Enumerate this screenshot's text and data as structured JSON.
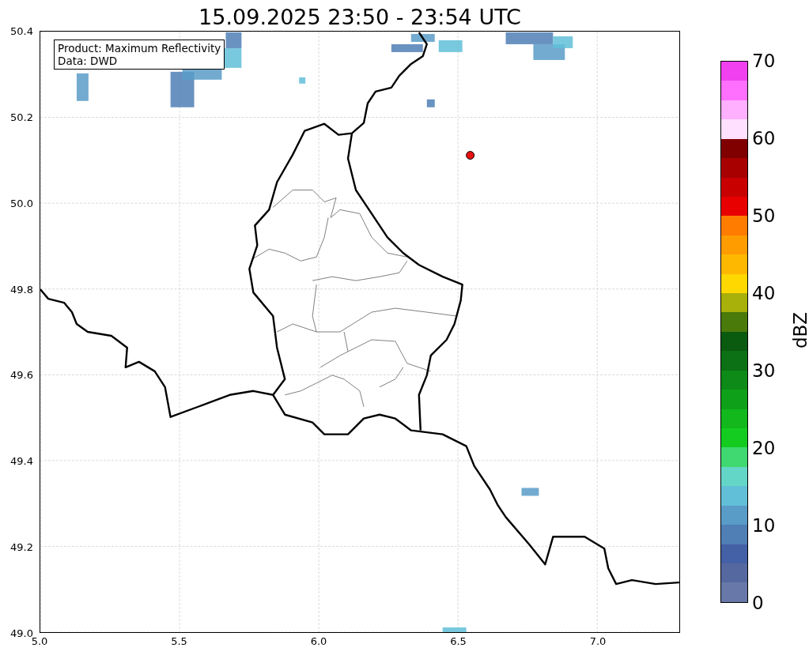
{
  "title": "15.09.2025 23:50 - 23:54 UTC",
  "legend": [
    "Product: Maximum Reflectivity",
    "Data: DWD"
  ],
  "x_ticks": [
    "5.0",
    "5.5",
    "6.0",
    "6.5",
    "7.0"
  ],
  "y_ticks": [
    "50.4",
    "50.2",
    "50.0",
    "49.8",
    "49.6",
    "49.4",
    "49.2",
    "49.0"
  ],
  "colorbar": {
    "label": "dBZ",
    "ticks": [
      "70",
      "60",
      "50",
      "40",
      "30",
      "20",
      "10",
      "0"
    ],
    "segments": [
      {
        "color": "#6878a8"
      },
      {
        "color": "#5668a0"
      },
      {
        "color": "#4460a6"
      },
      {
        "color": "#4f7fb5"
      },
      {
        "color": "#5a9cc8"
      },
      {
        "color": "#62bfd8"
      },
      {
        "color": "#64d6c8"
      },
      {
        "color": "#40d870"
      },
      {
        "color": "#14cc20"
      },
      {
        "color": "#12b81c"
      },
      {
        "color": "#0fa01a"
      },
      {
        "color": "#0e8a18"
      },
      {
        "color": "#0c7014"
      },
      {
        "color": "#0a5a10"
      },
      {
        "color": "#4a7a0a"
      },
      {
        "color": "#a8b00a"
      },
      {
        "color": "#ffd800"
      },
      {
        "color": "#ffb800"
      },
      {
        "color": "#ff9c00"
      },
      {
        "color": "#ff7c00"
      },
      {
        "color": "#e80000"
      },
      {
        "color": "#c80000"
      },
      {
        "color": "#a80000"
      },
      {
        "color": "#800000"
      },
      {
        "color": "#ffe0ff"
      },
      {
        "color": "#ffb0ff"
      },
      {
        "color": "#ff70ff"
      },
      {
        "color": "#f040f0"
      }
    ]
  }
}
